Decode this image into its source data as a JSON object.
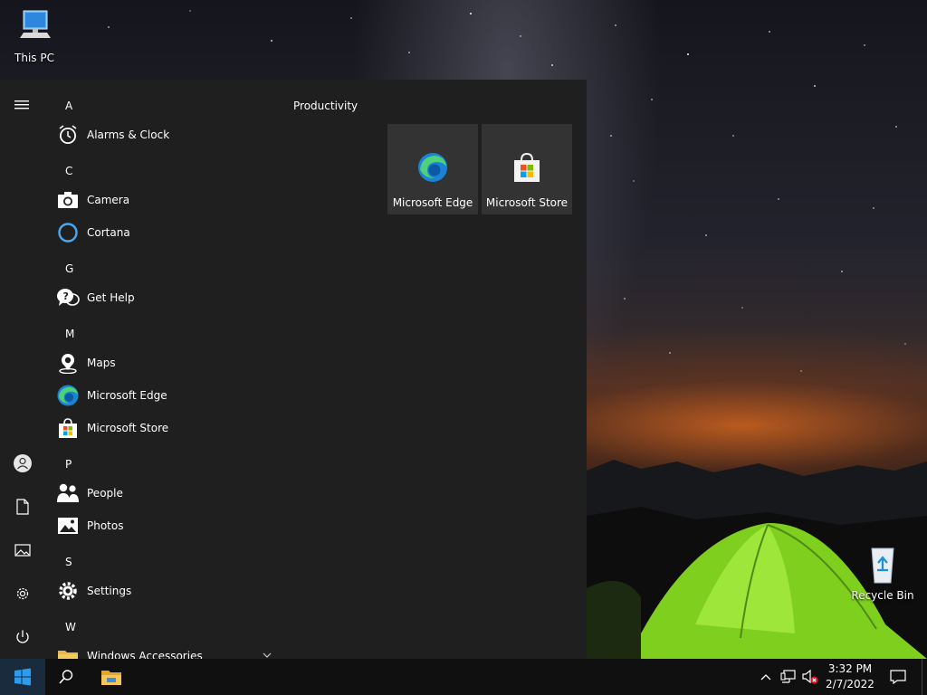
{
  "desktop": {
    "icons": [
      {
        "label": "This PC",
        "icon": "this-pc-icon"
      },
      {
        "label": "Recycle Bin",
        "icon": "recycle-bin-icon"
      }
    ]
  },
  "start_menu": {
    "app_list": {
      "letters": [
        "A",
        "C",
        "G",
        "M",
        "P",
        "S",
        "W"
      ],
      "apps": [
        {
          "label": "Alarms & Clock",
          "icon": "alarm-clock-icon"
        },
        {
          "label": "Camera",
          "icon": "camera-icon"
        },
        {
          "label": "Cortana",
          "icon": "cortana-icon"
        },
        {
          "label": "Get Help",
          "icon": "get-help-icon"
        },
        {
          "label": "Maps",
          "icon": "maps-icon"
        },
        {
          "label": "Microsoft Edge",
          "icon": "edge-icon"
        },
        {
          "label": "Microsoft Store",
          "icon": "store-icon"
        },
        {
          "label": "People",
          "icon": "people-icon"
        },
        {
          "label": "Photos",
          "icon": "photos-icon"
        },
        {
          "label": "Settings",
          "icon": "settings-icon"
        },
        {
          "label": "Windows Accessories",
          "icon": "folder-icon"
        }
      ]
    },
    "rail": [
      "hamburger-menu-icon",
      "user-account-icon",
      "documents-icon",
      "pictures-icon",
      "settings-icon",
      "power-icon"
    ],
    "tiles": {
      "group_title": "Productivity",
      "items": [
        {
          "label": "Microsoft Edge",
          "icon": "edge-icon"
        },
        {
          "label": "Microsoft Store",
          "icon": "store-icon"
        }
      ]
    }
  },
  "taskbar": {
    "buttons": [
      "windows-start-icon",
      "search-icon",
      "file-explorer-icon"
    ],
    "tray": [
      "chevron-up-icon",
      "network-icon",
      "volume-muted-icon"
    ],
    "clock": {
      "time": "3:32 PM",
      "date": "2/7/2022"
    },
    "notification": "action-center-icon"
  },
  "colors": {
    "start_bg": "#1f1f1f",
    "tile_bg": "#333333",
    "taskbar_bg": "#101010",
    "accent": "#0078d7"
  }
}
